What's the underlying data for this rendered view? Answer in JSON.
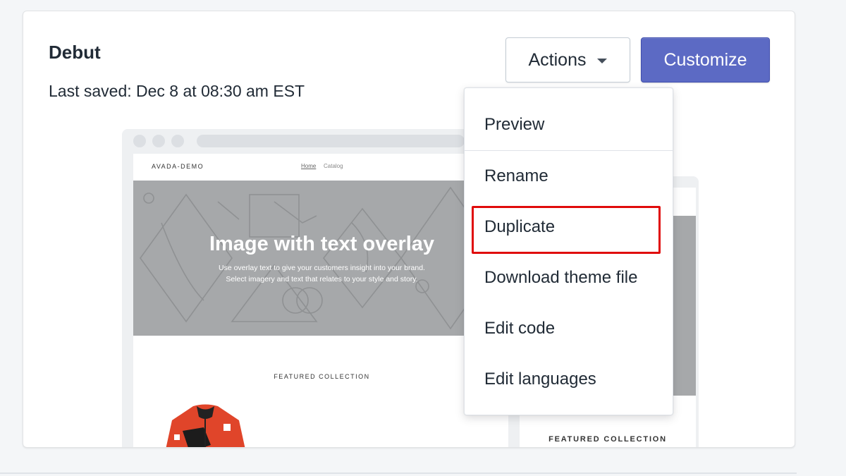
{
  "theme": {
    "name": "Debut",
    "last_saved": "Last saved: Dec 8 at 08:30 am EST"
  },
  "header_actions": {
    "actions_label": "Actions",
    "customize_label": "Customize"
  },
  "preview": {
    "logo": "AVADA-DEMO",
    "nav": [
      "Home",
      "Catalog"
    ],
    "hero_title": "Image with text overlay",
    "hero_subtitle_line1": "Use overlay text to give your customers insight into your brand.",
    "hero_subtitle_line2": "Select imagery and text that relates to your style and story.",
    "featured_label": "FEATURED COLLECTION",
    "mobile_featured_label": "FEATURED COLLECTION"
  },
  "actions_menu": {
    "items": [
      {
        "label": "Preview"
      },
      {
        "label": "Rename"
      },
      {
        "label": "Duplicate",
        "highlighted": true
      },
      {
        "label": "Download theme file"
      },
      {
        "label": "Edit code"
      },
      {
        "label": "Edit languages"
      }
    ]
  },
  "colors": {
    "primary": "#5c6ac4",
    "highlight_box": "#e00b0b",
    "hero_bg": "#a6a8aa",
    "jacket": "#e0452a"
  }
}
